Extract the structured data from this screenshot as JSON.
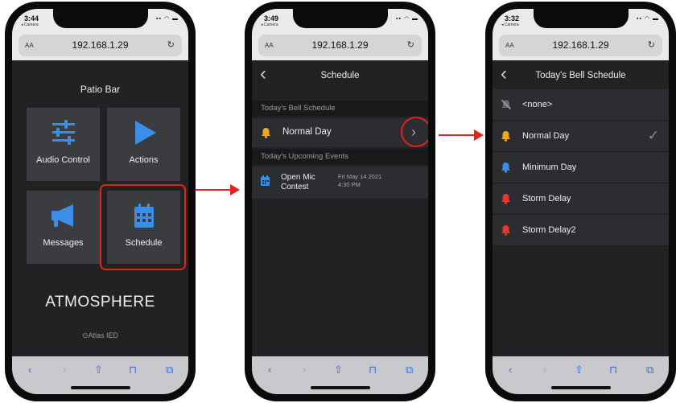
{
  "colors": {
    "accent_blue": "#3a8ee8",
    "bell_yellow": "#f2a81d",
    "bell_blue": "#3a8ee8",
    "bell_red": "#e4372d",
    "highlight_red": "#e2231a"
  },
  "phone1": {
    "time": "3:44",
    "back_app": "◂ Camera",
    "url": "192.168.1.29",
    "aa": "AA",
    "title": "Patio Bar",
    "tiles": [
      {
        "label": "Audio Control",
        "icon": "sliders-icon"
      },
      {
        "label": "Actions",
        "icon": "play-icon"
      },
      {
        "label": "Messages",
        "icon": "megaphone-icon"
      },
      {
        "label": "Schedule",
        "icon": "calendar-icon"
      }
    ],
    "logo": "ATMOSPHERE",
    "sublogo": "⊙Atlas IED"
  },
  "phone2": {
    "time": "3:49",
    "back_app": "◂ Camera",
    "url": "192.168.1.29",
    "aa": "AA",
    "title": "Schedule",
    "section1": "Today's Bell Schedule",
    "current": "Normal Day",
    "section2": "Today's Upcoming Events",
    "event": {
      "name": "Open Mic Contest",
      "date": "Fri May 14 2021",
      "time": "4:30 PM"
    }
  },
  "phone3": {
    "time": "3:32",
    "back_app": "◂ Camera",
    "url": "192.168.1.29",
    "aa": "AA",
    "title": "Today's Bell Schedule",
    "items": [
      {
        "label": "<none>",
        "bell": "bell-off-icon"
      },
      {
        "label": "Normal Day",
        "bell": "bell-icon",
        "selected": true
      },
      {
        "label": "Minimum Day",
        "bell": "bell-icon"
      },
      {
        "label": "Storm Delay",
        "bell": "bell-icon"
      },
      {
        "label": "Storm Delay2",
        "bell": "bell-icon"
      }
    ]
  }
}
